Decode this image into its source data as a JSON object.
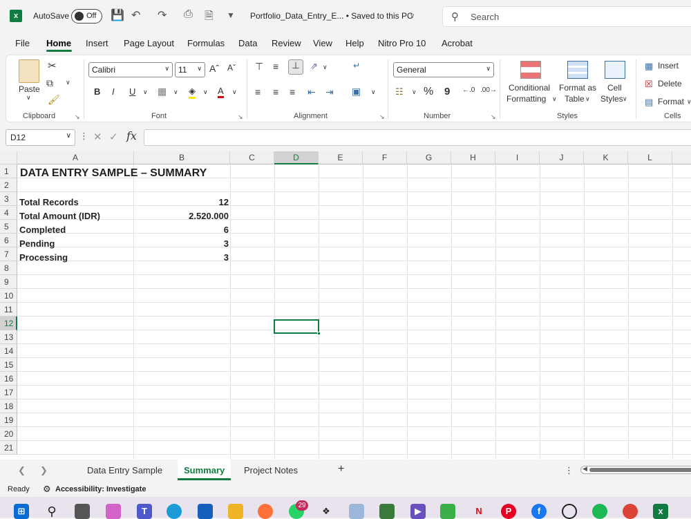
{
  "titlebar": {
    "autosave_label": "AutoSave",
    "autosave_state": "Off",
    "document_title": "Portfolio_Data_Entry_E... • Saved to this PC",
    "search_placeholder": "Search"
  },
  "menu_tabs": [
    "File",
    "Home",
    "Insert",
    "Page Layout",
    "Formulas",
    "Data",
    "Review",
    "View",
    "Help",
    "Nitro Pro 10",
    "Acrobat"
  ],
  "active_tab": "Home",
  "ribbon": {
    "clipboard": {
      "label": "Clipboard",
      "paste": "Paste"
    },
    "font": {
      "label": "Font",
      "font_name": "Calibri",
      "font_size": "11",
      "bold": "B",
      "italic": "I",
      "underline": "U"
    },
    "alignment": {
      "label": "Alignment"
    },
    "number": {
      "label": "Number",
      "format": "General",
      "percent": "%",
      "comma": "9"
    },
    "styles": {
      "label": "Styles",
      "conditional_1": "Conditional",
      "conditional_2": "Formatting",
      "format_table_1": "Format as",
      "format_table_2": "Table",
      "cell_styles_1": "Cell",
      "cell_styles_2": "Styles"
    },
    "cells": {
      "label": "Cells",
      "insert": "Insert",
      "delete": "Delete",
      "format": "Format"
    }
  },
  "formula_bar": {
    "name_box": "D12",
    "fx": "fx",
    "value": ""
  },
  "columns": [
    "A",
    "B",
    "C",
    "D",
    "E",
    "F",
    "G",
    "H",
    "I",
    "J",
    "K",
    "L"
  ],
  "selected_column": "D",
  "rows": [
    "1",
    "2",
    "3",
    "4",
    "5",
    "6",
    "7",
    "8",
    "9",
    "10",
    "11",
    "12",
    "13",
    "14",
    "15",
    "16",
    "17",
    "18",
    "19",
    "20",
    "21"
  ],
  "selected_row": "12",
  "sheet": {
    "title": "DATA ENTRY SAMPLE – SUMMARY",
    "records": [
      {
        "label": "Total Records",
        "value": "12"
      },
      {
        "label": "Total Amount (IDR)",
        "value": "2.520.000"
      },
      {
        "label": "Completed",
        "value": "6"
      },
      {
        "label": "Pending",
        "value": "3"
      },
      {
        "label": "Processing",
        "value": "3"
      }
    ]
  },
  "sheet_tabs": [
    "Data Entry Sample",
    "Summary",
    "Project Notes"
  ],
  "active_sheet": "Summary",
  "status": {
    "ready": "Ready",
    "accessibility": "Accessibility: Investigate"
  },
  "taskbar": {
    "whatsapp_badge": "29"
  }
}
